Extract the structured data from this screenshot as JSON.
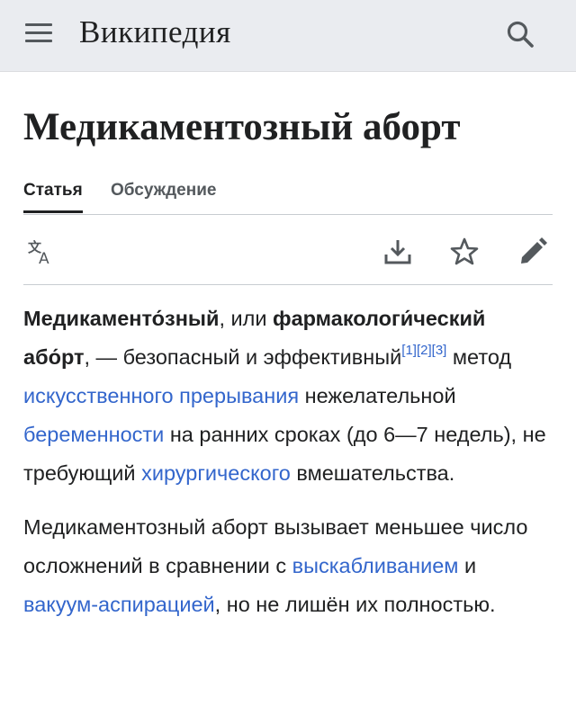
{
  "header": {
    "wordmark": "Википедия",
    "menu_icon": "hamburger-menu-icon",
    "search_icon": "search-icon",
    "background": "#eaecf0"
  },
  "page": {
    "title": "Медикаментозный аборт"
  },
  "tabs": [
    {
      "label": "Статья",
      "active": true
    },
    {
      "label": "Обсуждение",
      "active": false
    }
  ],
  "toolbar": {
    "language_icon": "language-icon",
    "download_icon": "download-icon",
    "watch_icon": "star-icon",
    "edit_icon": "pencil-icon"
  },
  "colors": {
    "link": "#3366cc",
    "text": "#202122",
    "icon": "#54595d"
  },
  "paragraph1": {
    "term1": "Медикаменто́зный",
    "t1": ", или ",
    "term2": "фармакологи́ческий або́рт",
    "t2": ", — безопасный и эффективный",
    "ref1": "[1]",
    "ref2": "[2]",
    "ref3": "[3]",
    "t3": " метод ",
    "link1": "искусственного прерывания",
    "t4": " нежелательной ",
    "link2": "беременности",
    "t5": " на ранних сроках (до 6—7 недель), не требующий ",
    "link3": "хирургического",
    "t6": " вмешательства."
  },
  "paragraph2": {
    "t1": "Медикаментозный аборт вызывает меньшее число осложнений в сравнении с ",
    "link1": "выскабливанием",
    "t2": " и ",
    "link2": "вакуум-аспирацией",
    "t3": ", но не лишён их полностью."
  }
}
